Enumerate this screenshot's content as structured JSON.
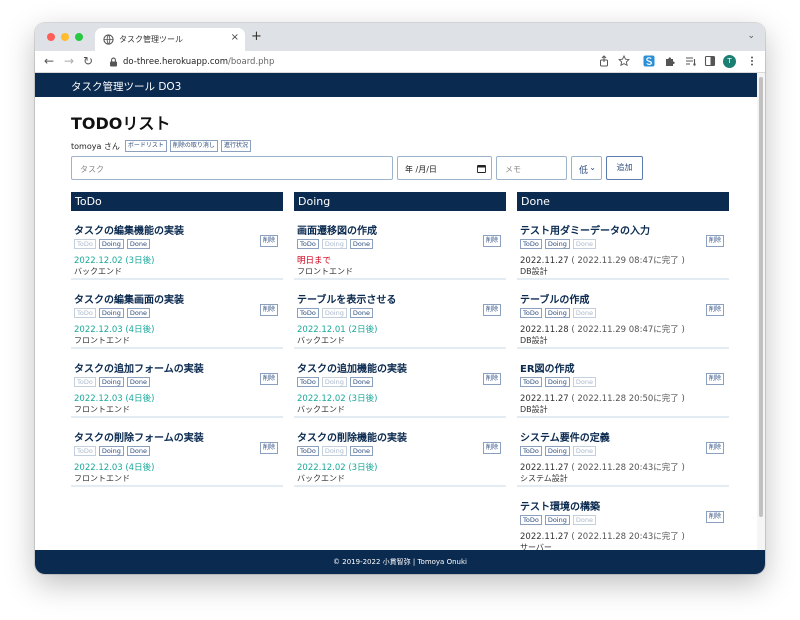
{
  "browser": {
    "tab_title": "タスク管理ツール",
    "tab_close": "×",
    "new_tab": "+",
    "tab_menu": "⌄",
    "url_host": "do-three.herokuapp.com",
    "url_path": "/board.php",
    "avatar_initial": "T",
    "nav": {
      "back": "←",
      "forward": "→",
      "reload": "↻"
    },
    "traffic_colors": [
      "#ff5f57",
      "#febc2e",
      "#28c840"
    ]
  },
  "header": {
    "site_title": "タスク管理ツール DO3"
  },
  "page": {
    "title": "TODOリスト"
  },
  "user": {
    "name": "tomoya さん",
    "links": [
      "ボードリスト",
      "削除の取り消し",
      "進行状況"
    ]
  },
  "form": {
    "task_placeholder": "タスク",
    "date_value": "年 /月/日",
    "memo_placeholder": "メモ",
    "priority_value": "低",
    "priority_chevron": "⌄",
    "add_label": "追加"
  },
  "labels": {
    "todo": "ToDo",
    "doing": "Doing",
    "done": "Done",
    "delete": "削除"
  },
  "colors": {
    "navy": "#0b2a4f",
    "due_ok": "#1aa89a",
    "due_urgent": "#d0021b"
  },
  "columns": [
    {
      "title": "ToDo",
      "cards": [
        {
          "title": "タスクの編集機能の実装",
          "due": "2022.12.02 (3日後)",
          "category": "バックエンド"
        },
        {
          "title": "タスクの編集画面の実装",
          "due": "2022.12.03 (4日後)",
          "category": "フロントエンド"
        },
        {
          "title": "タスクの追加フォームの実装",
          "due": "2022.12.03 (4日後)",
          "category": "フロントエンド"
        },
        {
          "title": "タスクの削除フォームの実装",
          "due": "2022.12.03 (4日後)",
          "category": "フロントエンド"
        }
      ]
    },
    {
      "title": "Doing",
      "cards": [
        {
          "title": "画面遷移図の作成",
          "due": "明日まで",
          "urgent": true,
          "category": "フロントエンド"
        },
        {
          "title": "テーブルを表示させる",
          "due": "2022.12.01 (2日後)",
          "category": "バックエンド"
        },
        {
          "title": "タスクの追加機能の実装",
          "due": "2022.12.02 (3日後)",
          "category": "バックエンド"
        },
        {
          "title": "タスクの削除機能の実装",
          "due": "2022.12.02 (3日後)",
          "category": "バックエンド"
        }
      ]
    },
    {
      "title": "Done",
      "cards": [
        {
          "title": "テスト用ダミーデータの入力",
          "date": "2022.11.27",
          "completed": "( 2022.11.29 08:47に完了 )",
          "category": "DB設計"
        },
        {
          "title": "テーブルの作成",
          "date": "2022.11.28",
          "completed": "( 2022.11.29 08:47に完了 )",
          "category": "DB設計"
        },
        {
          "title": "ER図の作成",
          "date": "2022.11.27",
          "completed": "( 2022.11.28 20:50に完了 )",
          "category": "DB設計"
        },
        {
          "title": "システム要件の定義",
          "date": "2022.11.27",
          "completed": "( 2022.11.28 20:43に完了 )",
          "category": "システム設計"
        },
        {
          "title": "テスト環境の構築",
          "date": "2022.11.27",
          "completed": "( 2022.11.28 20:43に完了 )",
          "category": "サーバー"
        }
      ]
    }
  ],
  "footer": {
    "text": "© 2019-2022 小貫智弥 | Tomoya Onuki"
  }
}
